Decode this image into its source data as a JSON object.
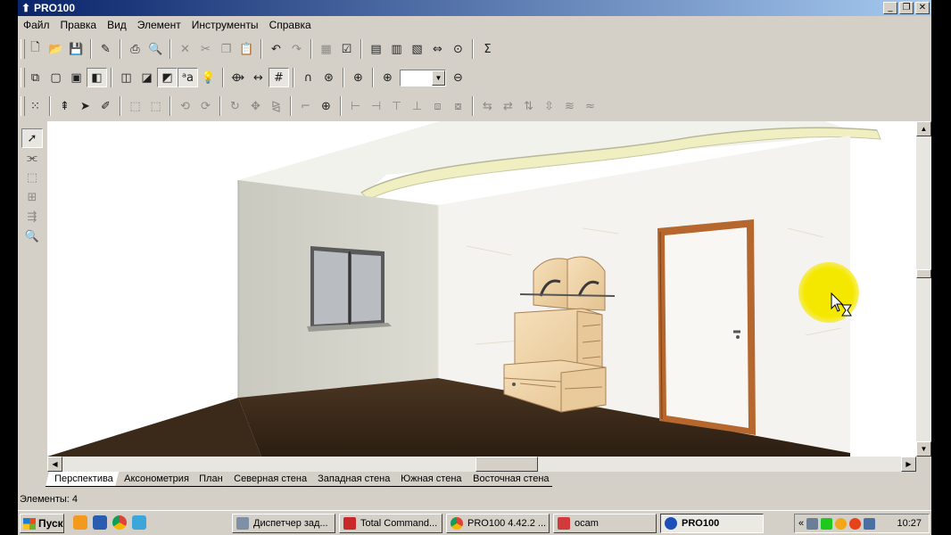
{
  "window": {
    "title": "PRO100",
    "controls": [
      "_",
      "❐",
      "✕"
    ]
  },
  "menu": [
    "Файл",
    "Правка",
    "Вид",
    "Элемент",
    "Инструменты",
    "Справка"
  ],
  "zoom": {
    "value": ""
  },
  "views": [
    "Перспектива",
    "Аксонометрия",
    "План",
    "Северная стена",
    "Западная стена",
    "Южная стена",
    "Восточная стена"
  ],
  "active_view": "Перспектива",
  "status": {
    "elements": "Элементы: 4"
  },
  "taskbar": {
    "start_label": "Пуск",
    "tasks": [
      {
        "label": "Диспетчер зад...",
        "icon": "task-manager-icon"
      },
      {
        "label": "Total Command...",
        "icon": "total-commander-icon"
      },
      {
        "label": "PRO100 4.42.2 ...",
        "icon": "chrome-icon"
      },
      {
        "label": "ocam",
        "icon": "ocam-icon"
      },
      {
        "label": "PRO100",
        "icon": "pro100-icon"
      }
    ],
    "tray_expand": "«",
    "clock": "10:27"
  },
  "colors": {
    "title_start": "#0a246a",
    "title_end": "#a6caf0",
    "face": "#d4d0c8",
    "floor": "#3b2a1a",
    "door_frame": "#b5672d",
    "cursor_highlight": "#f5e800"
  }
}
